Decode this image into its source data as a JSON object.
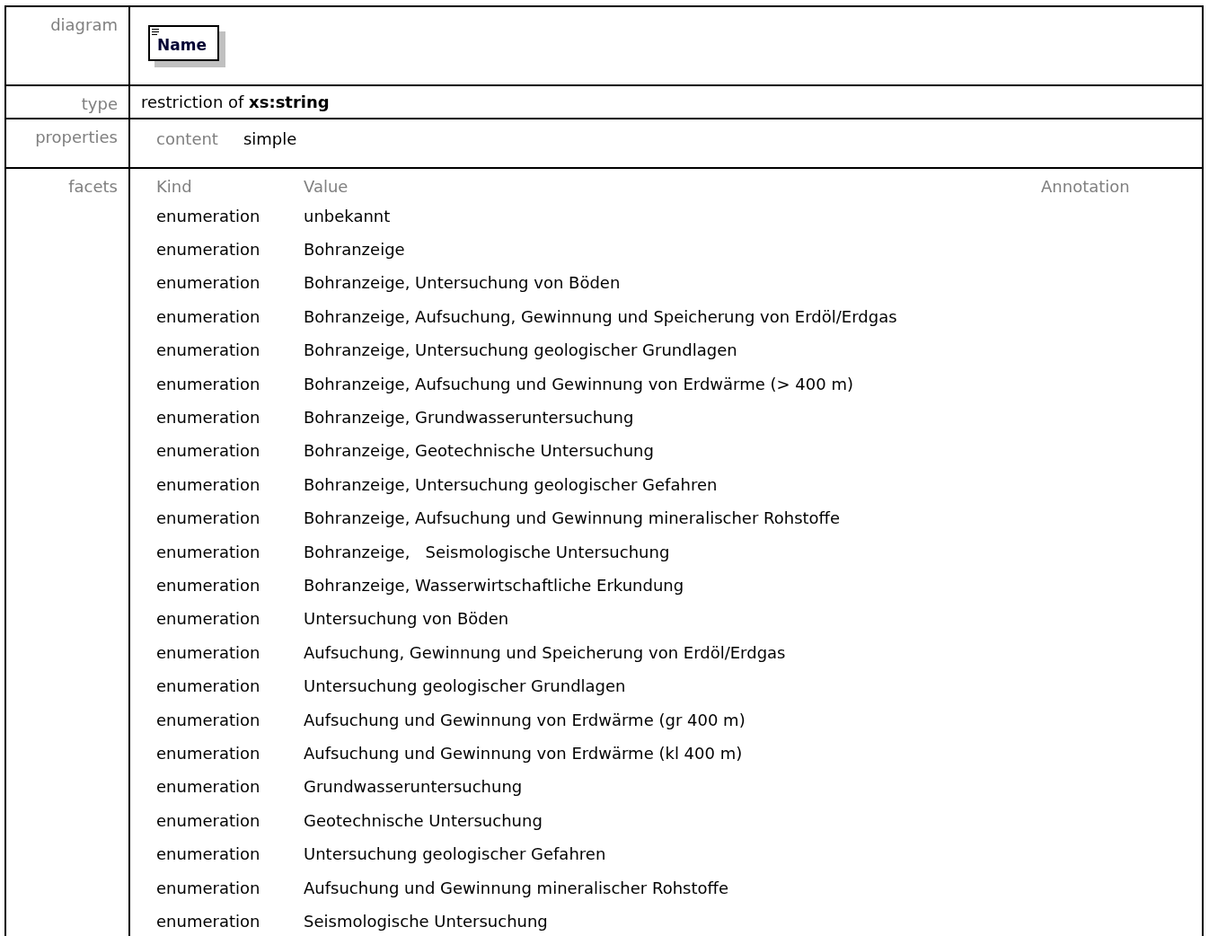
{
  "rows": [
    {
      "kind": "diagram",
      "label": "diagram",
      "element": "Name"
    },
    {
      "kind": "type",
      "label": "type",
      "prefix": "restriction of",
      "base": "xs:string"
    },
    {
      "kind": "properties",
      "label": "properties",
      "name": "content",
      "value": "simple"
    },
    {
      "kind": "facets",
      "label": "facets",
      "columns": [
        "Kind",
        "Value",
        "Annotation"
      ],
      "items": [
        {
          "kind": "enumeration",
          "value": "unbekannt"
        },
        {
          "kind": "enumeration",
          "value": "Bohranzeige"
        },
        {
          "kind": "enumeration",
          "value": "Bohranzeige, Untersuchung von Böden"
        },
        {
          "kind": "enumeration",
          "value": "Bohranzeige, Aufsuchung, Gewinnung und Speicherung von Erdöl/Erdgas"
        },
        {
          "kind": "enumeration",
          "value": "Bohranzeige, Untersuchung geologischer Grundlagen"
        },
        {
          "kind": "enumeration",
          "value": "Bohranzeige, Aufsuchung und Gewinnung von Erdwärme (> 400 m)"
        },
        {
          "kind": "enumeration",
          "value": "Bohranzeige, Grundwasseruntersuchung"
        },
        {
          "kind": "enumeration",
          "value": "Bohranzeige, Geotechnische Untersuchung"
        },
        {
          "kind": "enumeration",
          "value": "Bohranzeige, Untersuchung geologischer Gefahren"
        },
        {
          "kind": "enumeration",
          "value": "Bohranzeige, Aufsuchung und Gewinnung mineralischer Rohstoffe"
        },
        {
          "kind": "enumeration",
          "value": "Bohranzeige,   Seismologische Untersuchung"
        },
        {
          "kind": "enumeration",
          "value": "Bohranzeige, Wasserwirtschaftliche Erkundung"
        },
        {
          "kind": "enumeration",
          "value": "Untersuchung von Böden"
        },
        {
          "kind": "enumeration",
          "value": "Aufsuchung, Gewinnung und Speicherung von Erdöl/Erdgas"
        },
        {
          "kind": "enumeration",
          "value": "Untersuchung geologischer Grundlagen"
        },
        {
          "kind": "enumeration",
          "value": "Aufsuchung und Gewinnung von Erdwärme (gr 400 m)"
        },
        {
          "kind": "enumeration",
          "value": "Aufsuchung und Gewinnung von Erdwärme (kl 400 m)"
        },
        {
          "kind": "enumeration",
          "value": "Grundwasseruntersuchung"
        },
        {
          "kind": "enumeration",
          "value": "Geotechnische Untersuchung"
        },
        {
          "kind": "enumeration",
          "value": "Untersuchung geologischer Gefahren"
        },
        {
          "kind": "enumeration",
          "value": "Aufsuchung und Gewinnung mineralischer Rohstoffe"
        },
        {
          "kind": "enumeration",
          "value": "Seismologische Untersuchung"
        }
      ]
    }
  ]
}
